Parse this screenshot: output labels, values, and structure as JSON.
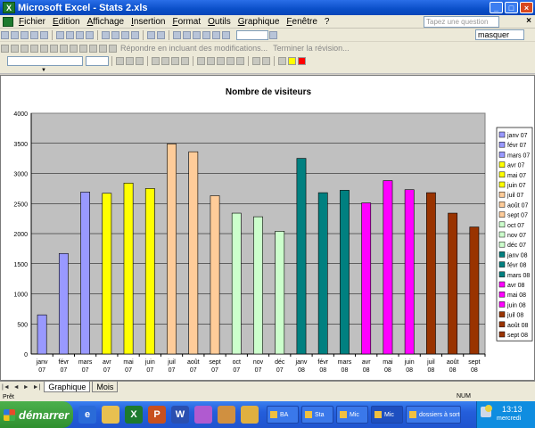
{
  "window": {
    "title": "Microsoft Excel - Stats 2.xls",
    "minimize": "_",
    "maximize": "□",
    "close": "×"
  },
  "menu": {
    "items": [
      "Fichier",
      "Edition",
      "Affichage",
      "Insertion",
      "Format",
      "Outils",
      "Graphique",
      "Fenêtre",
      "?"
    ],
    "question_placeholder": "Tapez une question",
    "doc_close": "×"
  },
  "toolbar": {
    "review_reply": "Répondre en incluant des modifications...",
    "review_end": "Terminer la révision...",
    "mask_value": "masquer"
  },
  "sheet_tabs": {
    "nav": [
      "|◄",
      "◄",
      "►",
      "►|"
    ],
    "tabs": [
      "Graphique",
      "Mois"
    ]
  },
  "status": {
    "ready": "Prêt",
    "num": "NUM"
  },
  "taskbar": {
    "start": "démarrer",
    "quicklaunch": [
      {
        "icon": "internet-explorer-icon",
        "glyph": "e",
        "color": "#2a6bd8"
      },
      {
        "icon": "folder-icon",
        "glyph": "",
        "color": "#e8c050"
      },
      {
        "icon": "excel-icon",
        "glyph": "X",
        "color": "#1d7a2e"
      },
      {
        "icon": "powerpoint-icon",
        "glyph": "P",
        "color": "#c8501e"
      },
      {
        "icon": "word-icon",
        "glyph": "W",
        "color": "#2a4fb0"
      },
      {
        "icon": "paint-icon",
        "glyph": "",
        "color": "#b05ad0"
      },
      {
        "icon": "brush-icon",
        "glyph": "",
        "color": "#d09040"
      },
      {
        "icon": "photo-icon",
        "glyph": "",
        "color": "#e0b040"
      }
    ],
    "tasks": [
      "BA",
      "Sta",
      "Mic",
      "Mic",
      "dossiers à sorter"
    ],
    "clock": "13:13",
    "day": "mercredi"
  },
  "chart_data": {
    "type": "bar",
    "title": "Nombre de visiteurs",
    "xlabel": "",
    "ylabel": "",
    "ylim": [
      0,
      4000
    ],
    "yticks": [
      0,
      500,
      1000,
      1500,
      2000,
      2500,
      3000,
      3500,
      4000
    ],
    "grid": true,
    "legend_position": "right",
    "categories": [
      "janv 07",
      "févr 07",
      "mars 07",
      "avr 07",
      "mai 07",
      "juin 07",
      "juil 07",
      "août 07",
      "sept 07",
      "oct 07",
      "nov 07",
      "déc 07",
      "janv 08",
      "févr 08",
      "mars 08",
      "avr 08",
      "mai 08",
      "juin 08",
      "juil 08",
      "août 08",
      "sept 08"
    ],
    "tick_labels": [
      [
        "janv",
        "07"
      ],
      [
        "févr",
        "07"
      ],
      [
        "mars",
        "07"
      ],
      [
        "avr",
        "07"
      ],
      [
        "mai",
        "07"
      ],
      [
        "juin",
        "07"
      ],
      [
        "juil",
        "07"
      ],
      [
        "août",
        "07"
      ],
      [
        "sept",
        "07"
      ],
      [
        "oct",
        "07"
      ],
      [
        "nov",
        "07"
      ],
      [
        "déc",
        "07"
      ],
      [
        "janv",
        "08"
      ],
      [
        "févr",
        "08"
      ],
      [
        "mars",
        "08"
      ],
      [
        "avr",
        "08"
      ],
      [
        "mai",
        "08"
      ],
      [
        "juin",
        "08"
      ],
      [
        "juil",
        "08"
      ],
      [
        "août",
        "08"
      ],
      [
        "sept",
        "08"
      ]
    ],
    "values": [
      650,
      1670,
      2690,
      2670,
      2840,
      2750,
      3490,
      3360,
      2630,
      2340,
      2280,
      2040,
      3250,
      2680,
      2720,
      2510,
      2880,
      2730,
      2680,
      2340,
      2110
    ],
    "colors": [
      "#9999ff",
      "#9999ff",
      "#9999ff",
      "#ffff00",
      "#ffff00",
      "#ffff00",
      "#ffcc99",
      "#ffcc99",
      "#ffcc99",
      "#ccffcc",
      "#ccffcc",
      "#ccffcc",
      "#008080",
      "#008080",
      "#008080",
      "#ff00ff",
      "#ff00ff",
      "#ff00ff",
      "#993300",
      "#993300",
      "#993300"
    ],
    "legend": [
      "janv 07",
      "févr 07",
      "mars 07",
      "avr 07",
      "mai 07",
      "juin 07",
      "juil 07",
      "août 07",
      "sept 07",
      "oct 07",
      "nov 07",
      "déc 07",
      "janv 08",
      "févr 08",
      "mars 08",
      "avr 08",
      "mai 08",
      "juin 08",
      "juil 08",
      "août 08",
      "sept 08"
    ],
    "plot_background": "#c0c0c0"
  }
}
